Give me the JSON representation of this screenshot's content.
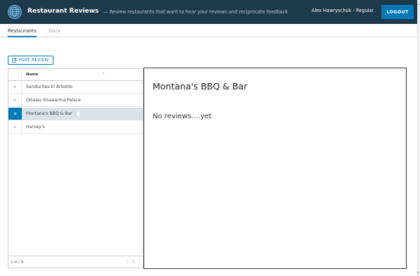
{
  "header": {
    "app_title": "Restaurant Reviews",
    "app_subtitle": "— Review restaurants that want to hear your reviews and reciprocate feedback",
    "user": "Alex Hawryschuk - Regular",
    "logout_label": "LOGOUT",
    "logo_icon": "globe-icon",
    "bg_color": "#1c3a4c",
    "accent_color": "#0079b8"
  },
  "tabs": [
    {
      "label": "Restaurants",
      "active": true
    },
    {
      "label": "Docs",
      "active": false
    }
  ],
  "toolbar": {
    "post_icon": "edit-icon",
    "post_label": "POST REVIEW"
  },
  "grid": {
    "column_header": "Name",
    "filter_icon": "filter-icon",
    "rows": [
      {
        "name": "Sanduches El Arbolito",
        "selected": false
      },
      {
        "name": "Ottawa Shawarma Palace",
        "selected": false
      },
      {
        "name": "Montana's BBQ & Bar",
        "selected": true
      },
      {
        "name": "Harvey's",
        "selected": false
      }
    ],
    "footer_count": "1-4 / 4",
    "pager_prev": "‹",
    "pager_page": "1",
    "pager_next": "›"
  },
  "detail": {
    "title": "Montana's BBQ & Bar",
    "message": "No reviews....yet"
  }
}
